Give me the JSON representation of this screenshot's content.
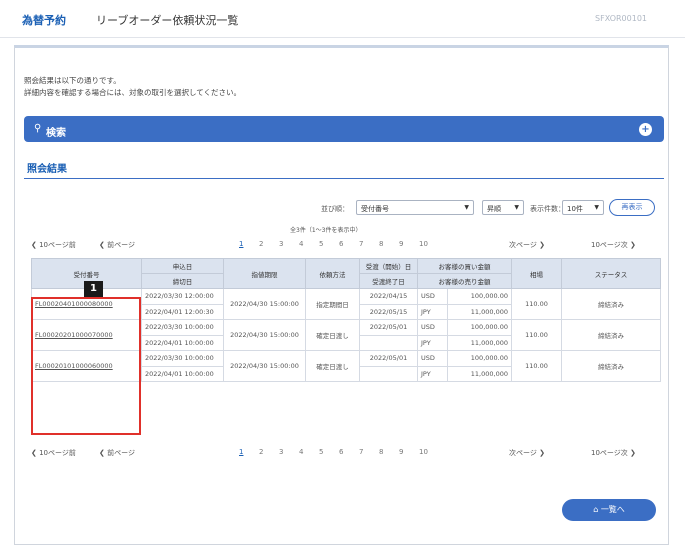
{
  "header": {
    "category": "為替予約",
    "title": "リーブオーダー依頼状況一覧",
    "screen_id": "SFXOR00101"
  },
  "intro": {
    "line1": "照会結果は以下の通りです。",
    "line2": "詳細内容を確認する場合には、対象の取引を選択してください。"
  },
  "search": {
    "icon": "search-icon",
    "label": "検索",
    "toggle_icon": "expand-icon"
  },
  "section": {
    "title": "照会結果"
  },
  "controls": {
    "sort_label": "並び順：",
    "sort_value": "受付番号",
    "order_value": "昇順",
    "per_page_label": "表示件数：",
    "per_page_value": "10件",
    "show_button": "再表示"
  },
  "count": "全3件（1～3件を表示中）",
  "pager": {
    "prev10": "10ページ前",
    "prev": "前ページ",
    "pages": [
      "1",
      "2",
      "3",
      "4",
      "5",
      "6",
      "7",
      "8",
      "9",
      "10"
    ],
    "next": "次ページ",
    "next10": "10ページ次"
  },
  "table": {
    "headers": {
      "ref_no": "受付番号",
      "order_date": "申込日",
      "process_date": "締切日",
      "limit_time": "指値期限",
      "order_type": "依頼方法",
      "value_date": "受渡（開始）日",
      "value_end": "受渡終了日",
      "buy_ccy": "お客様の買い金額",
      "sell_ccy": "お客様の売り金額",
      "rate": "相場",
      "status": "ステータス"
    },
    "rows": [
      {
        "ref_no": "FL00020401000080000",
        "order_date": "2022/03/30 12:00:00",
        "process_date": "2022/04/01 12:00:30",
        "limit_time": "2022/04/30 15:00:00",
        "order_type": "指定期間日",
        "value_date": "2022/04/15",
        "value_end": "2022/05/15",
        "buy_ccy": "USD",
        "buy_amt": "100,000.00",
        "sell_ccy": "JPY",
        "sell_amt": "11,000,000",
        "rate": "110.00",
        "status": "締結済み"
      },
      {
        "ref_no": "FL00020201000070000",
        "order_date": "2022/03/30 10:00:00",
        "process_date": "2022/04/01 10:00:00",
        "limit_time": "2022/04/30 15:00:00",
        "order_type": "確定日渡し",
        "value_date": "2022/05/01",
        "value_end": "",
        "buy_ccy": "USD",
        "buy_amt": "100,000.00",
        "sell_ccy": "JPY",
        "sell_amt": "11,000,000",
        "rate": "110.00",
        "status": "締結済み"
      },
      {
        "ref_no": "FL00020101000060000",
        "order_date": "2022/03/30 10:00:00",
        "process_date": "2022/04/01 10:00:00",
        "limit_time": "2022/04/30 15:00:00",
        "order_type": "確定日渡し",
        "value_date": "2022/05/01",
        "value_end": "",
        "buy_ccy": "USD",
        "buy_amt": "100,000.00",
        "sell_ccy": "JPY",
        "sell_amt": "11,000,000",
        "rate": "110.00",
        "status": "締結済み"
      }
    ]
  },
  "marker": "1",
  "top_button": "一覧へ",
  "colors": {
    "accent": "#3b6ec4",
    "link": "#2a5db0",
    "highlight": "#e0302a"
  }
}
